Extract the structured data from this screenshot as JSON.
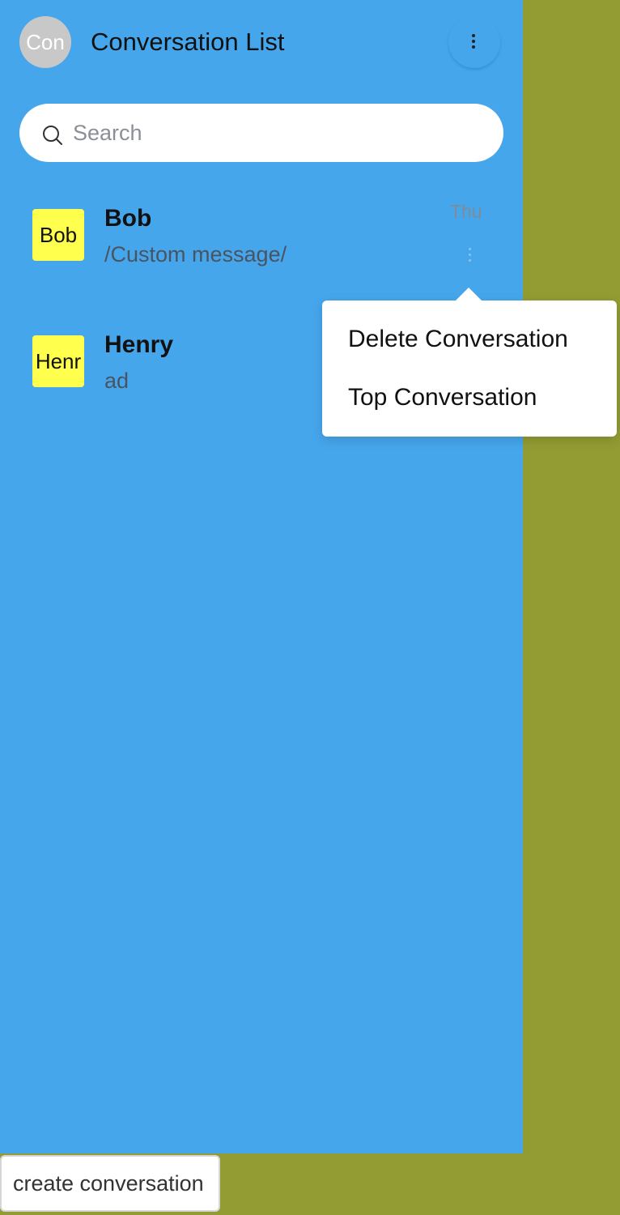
{
  "header": {
    "avatar_text": "Con",
    "title": "Conversation List",
    "menu_icon": "more-vertical-icon"
  },
  "search": {
    "placeholder": "Search",
    "icon": "search-icon"
  },
  "conversations": [
    {
      "avatar_text": "Bob",
      "name": "Bob",
      "last_message": "/Custom message/",
      "time": "Thu"
    },
    {
      "avatar_text": "Henr",
      "name": "Henry",
      "last_message": "ad",
      "time": ""
    }
  ],
  "context_menu": {
    "items": [
      "Delete Conversation",
      "Top Conversation"
    ]
  },
  "footer": {
    "create_label": "create conversation"
  },
  "colors": {
    "panel": "#46a6ec",
    "background": "#929c33",
    "avatar": "#ffff4d"
  }
}
